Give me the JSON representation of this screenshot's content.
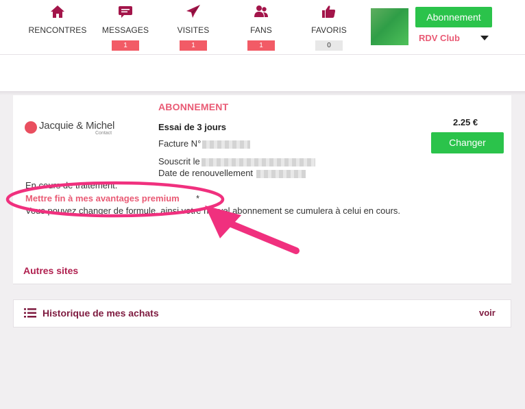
{
  "nav": {
    "items": [
      {
        "label": "RENCONTRES",
        "icon": "home-icon",
        "badge": ""
      },
      {
        "label": "MESSAGES",
        "icon": "chat-bubble-icon",
        "badge": "1"
      },
      {
        "label": "VISITES",
        "icon": "paper-plane-icon",
        "badge": "1"
      },
      {
        "label": "FANS",
        "icon": "users-icon",
        "badge": "1"
      },
      {
        "label": "FAVORIS",
        "icon": "thumbs-up-icon",
        "badge": "0"
      }
    ]
  },
  "account": {
    "subscribe_label": "Abonnement",
    "club_name": "RDV Club"
  },
  "subscription": {
    "section_title": "ABONNEMENT",
    "logo_brand": "Jacquie & Michel",
    "logo_sub": "Contact",
    "plan": "Essai de 3 jours",
    "invoice_label": "Facture N°",
    "subscribed_label": "Souscrit le",
    "renewal_label": "Date de renouvellement",
    "price": "2.25 €",
    "change_label": "Changer",
    "pending_text": "En cours de traitement.",
    "cancel_link": "Mettre fin à mes avantages premium",
    "asterisk": "*",
    "note": "Vous pouvez changer de formule, ainsi votre nouvel abonnement se cumulera à celui en cours."
  },
  "other_sites": {
    "title": "Autres sites"
  },
  "history": {
    "title": "Historique de mes achats",
    "action": "voir"
  },
  "colors": {
    "accent_pink": "#e95a74",
    "dark_magenta": "#7e1a3f",
    "green": "#2bc34b",
    "annotation": "#f0307e"
  }
}
